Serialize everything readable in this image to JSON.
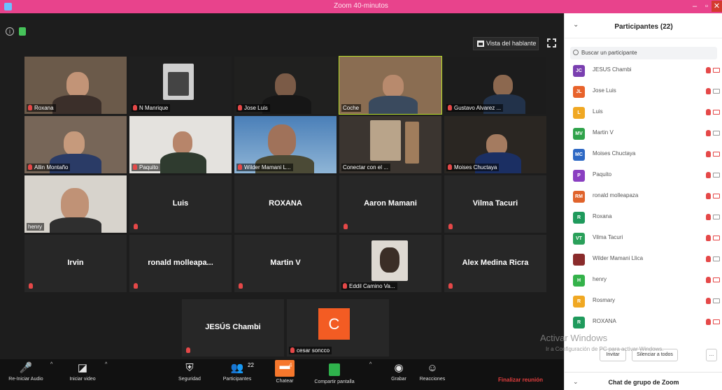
{
  "window": {
    "title": "Zoom 40-minutos"
  },
  "top": {
    "view_label": "Vista del hablante"
  },
  "tiles": [
    {
      "name": "Roxana"
    },
    {
      "name": "N Manrique"
    },
    {
      "name": "Jose Luis"
    },
    {
      "name": "Coche"
    },
    {
      "name": "Gustavo Alvarez ..."
    },
    {
      "name": "Allin Montaño"
    },
    {
      "name": "Paquito"
    },
    {
      "name": "Wilder Mamani L..."
    },
    {
      "name": "Conectar con el ..."
    },
    {
      "name": "Moises Chuctaya"
    },
    {
      "name": "henry"
    },
    {
      "name": "Luis"
    },
    {
      "name": "ROXANA"
    },
    {
      "name": "Aaron Mamani"
    },
    {
      "name": "Vilma Tacuri"
    },
    {
      "name": "Irvin"
    },
    {
      "name": "ronald molleapa..."
    },
    {
      "name": "Martin V"
    },
    {
      "name": "Eddil Camino Va..."
    },
    {
      "name": "Alex Medina Ricra"
    },
    {
      "name": "JESÚS Chambi"
    },
    {
      "name": "cesar soncco",
      "avatar": "C"
    }
  ],
  "toolbar": {
    "audio": "Re-Iniciar Audio",
    "video": "Iniciar video",
    "security": "Seguridad",
    "participants": "Participantes",
    "participants_count": "22",
    "chat": "Chatear",
    "chat_badge": "4",
    "share": "Compartir pantalla",
    "record": "Grabar",
    "reactions": "Reacciones",
    "end": "Finalizar reunión"
  },
  "panel": {
    "title": "Participantes (22)",
    "search_placeholder": "Buscar un participante",
    "participants": [
      {
        "initials": "JC",
        "name": "JESUS Chambi",
        "color": "#7a3fb0"
      },
      {
        "initials": "JL",
        "name": "Jose Luis",
        "color": "#e8632b"
      },
      {
        "initials": "L",
        "name": "Luis",
        "color": "#f0a823"
      },
      {
        "initials": "MV",
        "name": "Martin V",
        "color": "#2fa24a"
      },
      {
        "initials": "MC",
        "name": "Moises Chuctaya",
        "color": "#2d68c4"
      },
      {
        "initials": "P",
        "name": "Paquito",
        "color": "#8a3fc1"
      },
      {
        "initials": "RM",
        "name": "ronald molleapaza",
        "color": "#e0632b"
      },
      {
        "initials": "R",
        "name": "Roxana",
        "color": "#1f9a5c"
      },
      {
        "initials": "VT",
        "name": "Vilma Tacuri",
        "color": "#2aa05a"
      },
      {
        "initials": "",
        "name": "Wilder Mamani Llica",
        "color": "#8a2b2b"
      },
      {
        "initials": "H",
        "name": "henry",
        "color": "#34b24a"
      },
      {
        "initials": "R",
        "name": "Rosmary",
        "color": "#f0a823"
      },
      {
        "initials": "R",
        "name": "ROXANA",
        "color": "#1f9a5c"
      }
    ],
    "invite": "Invitar",
    "mute_all": "Silenciar a todos",
    "more": "...",
    "chat_title": "Chat de grupo de Zoom"
  },
  "watermark": {
    "line1": "Activar Windows",
    "line2": "Ir a Configuración de PC para activar Windows."
  }
}
